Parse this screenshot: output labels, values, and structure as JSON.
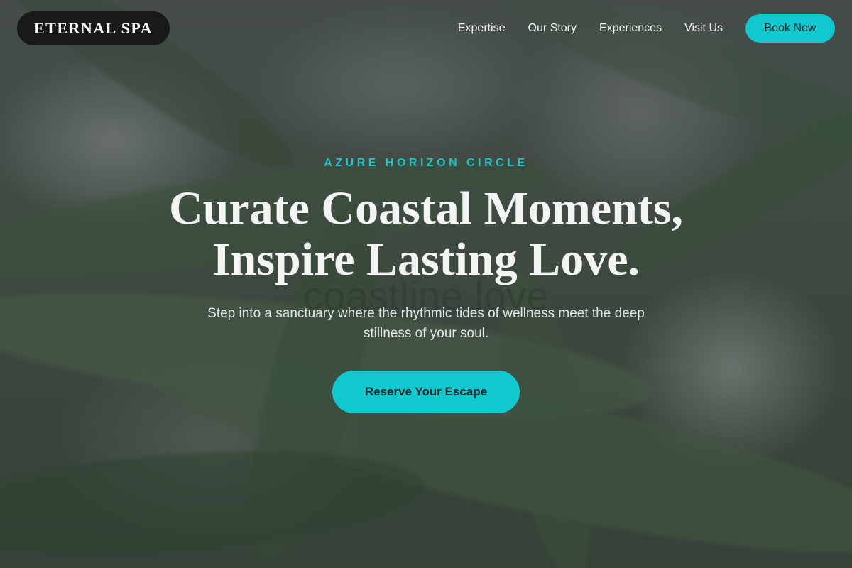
{
  "brand": {
    "name": "ETERNAL SPA"
  },
  "nav": {
    "links": [
      "Expertise",
      "Our Story",
      "Experiences",
      "Visit Us"
    ],
    "book_label": "Book Now"
  },
  "hero": {
    "eyebrow": "AZURE HORIZON CIRCLE",
    "title_line1": "Curate Coastal Moments,",
    "title_line2": "Inspire Lasting Love.",
    "ghost_text": "coastline love",
    "subtitle": "Step into a sanctuary where the rhythmic tides of wellness meet the deep stillness of your soul.",
    "cta_label": "Reserve Your Escape"
  },
  "colors": {
    "accent": "#0fc9cf",
    "brand_bg": "#181a1a",
    "eyebrow": "#1fc6cc"
  }
}
